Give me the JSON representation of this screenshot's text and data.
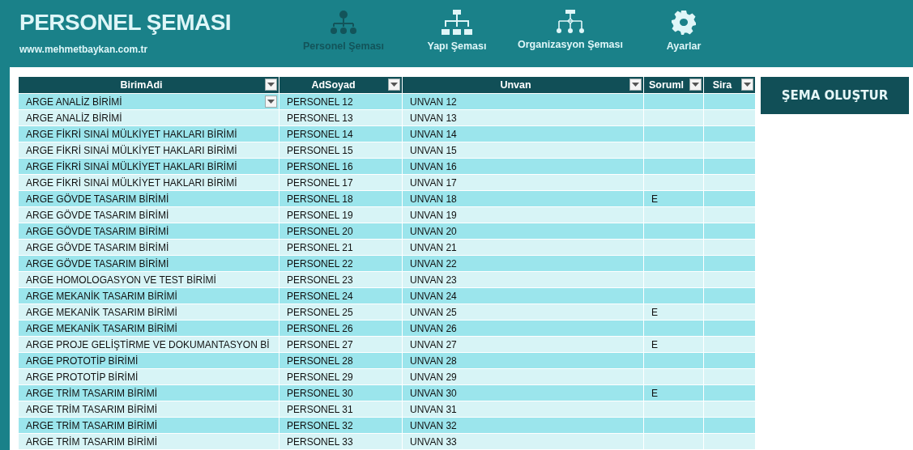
{
  "header": {
    "title": "PERSONEL ŞEMASI",
    "website": "www.mehmetbaykan.com.tr"
  },
  "nav": [
    {
      "kind": "people",
      "label": "Personel Şeması",
      "selected": true
    },
    {
      "kind": "structure",
      "label": "Yapı Şeması",
      "selected": false
    },
    {
      "kind": "organization",
      "label": "Organizasyon Şeması",
      "selected": false
    },
    {
      "kind": "settings",
      "label": "Ayarlar",
      "selected": false
    }
  ],
  "table": {
    "columns": [
      "BirimAdi",
      "AdSoyad",
      "Unvan",
      "Soruml",
      "Sira"
    ],
    "rows": [
      [
        "ARGE ANALİZ BİRİMİ",
        "PERSONEL 12",
        "UNVAN 12",
        "",
        ""
      ],
      [
        "ARGE ANALİZ BİRİMİ",
        "PERSONEL 13",
        "UNVAN 13",
        "",
        ""
      ],
      [
        "ARGE FİKRİ SINAİ MÜLKİYET HAKLARI BİRİMİ",
        "PERSONEL 14",
        "UNVAN 14",
        "",
        ""
      ],
      [
        "ARGE FİKRİ SINAİ MÜLKİYET HAKLARI BİRİMİ",
        "PERSONEL 15",
        "UNVAN 15",
        "",
        ""
      ],
      [
        "ARGE FİKRİ SINAİ MÜLKİYET HAKLARI BİRİMİ",
        "PERSONEL 16",
        "UNVAN 16",
        "",
        ""
      ],
      [
        "ARGE FİKRİ SINAİ MÜLKİYET HAKLARI BİRİMİ",
        "PERSONEL 17",
        "UNVAN 17",
        "",
        ""
      ],
      [
        "ARGE GÖVDE TASARIM BİRİMİ",
        "PERSONEL 18",
        "UNVAN 18",
        "E",
        ""
      ],
      [
        "ARGE GÖVDE TASARIM BİRİMİ",
        "PERSONEL 19",
        "UNVAN 19",
        "",
        ""
      ],
      [
        "ARGE GÖVDE TASARIM BİRİMİ",
        "PERSONEL 20",
        "UNVAN 20",
        "",
        ""
      ],
      [
        "ARGE GÖVDE TASARIM BİRİMİ",
        "PERSONEL 21",
        "UNVAN 21",
        "",
        ""
      ],
      [
        "ARGE GÖVDE TASARIM BİRİMİ",
        "PERSONEL 22",
        "UNVAN 22",
        "",
        ""
      ],
      [
        "ARGE HOMOLOGASYON VE TEST BİRİMİ",
        "PERSONEL 23",
        "UNVAN 23",
        "",
        ""
      ],
      [
        "ARGE MEKANİK TASARIM BİRİMİ",
        "PERSONEL 24",
        "UNVAN 24",
        "",
        ""
      ],
      [
        "ARGE MEKANİK TASARIM BİRİMİ",
        "PERSONEL 25",
        "UNVAN 25",
        "E",
        ""
      ],
      [
        "ARGE MEKANİK TASARIM BİRİMİ",
        "PERSONEL 26",
        "UNVAN 26",
        "",
        ""
      ],
      [
        "ARGE PROJE GELİŞTİRME VE DOKUMANTASYON Bİ",
        "PERSONEL 27",
        "UNVAN 27",
        "E",
        ""
      ],
      [
        "ARGE PROTOTİP BİRİMİ",
        "PERSONEL 28",
        "UNVAN 28",
        "",
        ""
      ],
      [
        "ARGE PROTOTİP BİRİMİ",
        "PERSONEL 29",
        "UNVAN 29",
        "",
        ""
      ],
      [
        "ARGE TRİM TASARIM BİRİMİ",
        "PERSONEL 30",
        "UNVAN 30",
        "E",
        ""
      ],
      [
        "ARGE TRİM TASARIM BİRİMİ",
        "PERSONEL 31",
        "UNVAN 31",
        "",
        ""
      ],
      [
        "ARGE TRİM TASARIM BİRİMİ",
        "PERSONEL 32",
        "UNVAN 32",
        "",
        ""
      ],
      [
        "ARGE TRİM TASARIM BİRİMİ",
        "PERSONEL 33",
        "UNVAN 33",
        "",
        ""
      ]
    ]
  },
  "action_button": "ŞEMA OLUŞTUR"
}
